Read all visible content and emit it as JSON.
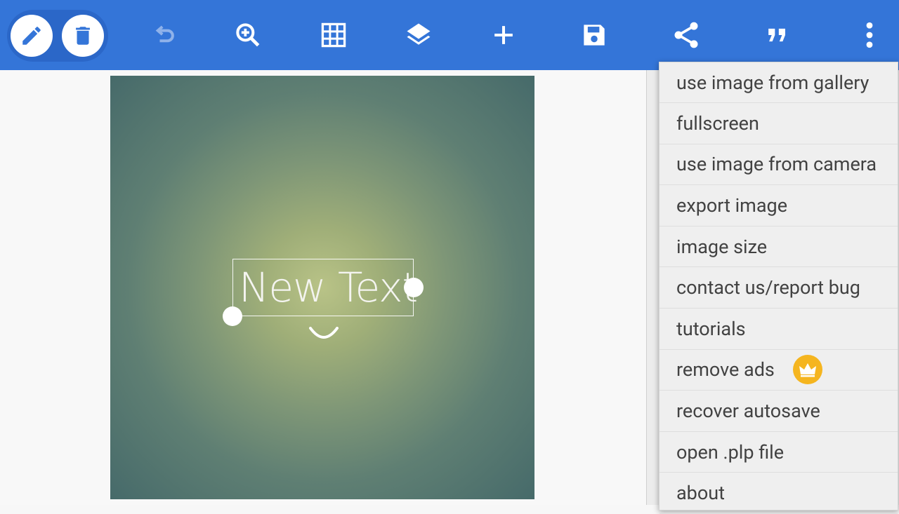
{
  "toolbar": {
    "icons": [
      "pencil-icon",
      "trash-icon",
      "undo-icon",
      "zoom-in-icon",
      "grid-icon",
      "layers-icon",
      "add-icon",
      "save-icon",
      "share-icon",
      "quote-icon",
      "more-vert-icon"
    ],
    "background": "#3475d8"
  },
  "canvas": {
    "text_layer": "New Text"
  },
  "menu": {
    "items": [
      {
        "label": "use image from gallery"
      },
      {
        "label": "fullscreen"
      },
      {
        "label": "use image from camera"
      },
      {
        "label": "export image"
      },
      {
        "label": "image size"
      },
      {
        "label": "contact us/report bug"
      },
      {
        "label": "tutorials"
      },
      {
        "label": "remove ads",
        "badge_icon": "crown-icon",
        "badge_color": "#f5b51f"
      },
      {
        "label": "recover autosave"
      },
      {
        "label": "open .plp file"
      },
      {
        "label": "about"
      }
    ]
  }
}
